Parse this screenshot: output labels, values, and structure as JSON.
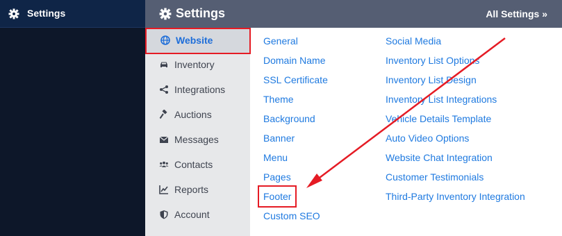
{
  "left_nav": {
    "title": "Settings",
    "icon": "gear-icon"
  },
  "header": {
    "title": "Settings",
    "all_settings": "All Settings »",
    "icon": "gear-icon"
  },
  "sub_nav": [
    {
      "label": "Website",
      "icon": "globe-icon",
      "active": true
    },
    {
      "label": "Inventory",
      "icon": "car-icon"
    },
    {
      "label": "Integrations",
      "icon": "share-icon"
    },
    {
      "label": "Auctions",
      "icon": "gavel-icon"
    },
    {
      "label": "Messages",
      "icon": "envelope-icon"
    },
    {
      "label": "Contacts",
      "icon": "users-icon"
    },
    {
      "label": "Reports",
      "icon": "chart-icon"
    },
    {
      "label": "Account",
      "icon": "shield-icon"
    }
  ],
  "links_col1": [
    "General",
    "Domain Name",
    "SSL Certificate",
    "Theme",
    "Background",
    "Banner",
    "Menu",
    "Pages",
    "Footer",
    "Custom SEO"
  ],
  "links_col2": [
    "Social Media",
    "Inventory List Options",
    "Inventory List Design",
    "Inventory List Integrations",
    "Vehicle Details Template",
    "Auto Video Options",
    "Website Chat Integration",
    "Customer Testimonials",
    "Third-Party Inventory Integration"
  ],
  "colors": {
    "link": "#1f7ae0",
    "highlight": "#e51b24",
    "header_bg": "#555e73",
    "nav_bg": "#0d1729"
  }
}
